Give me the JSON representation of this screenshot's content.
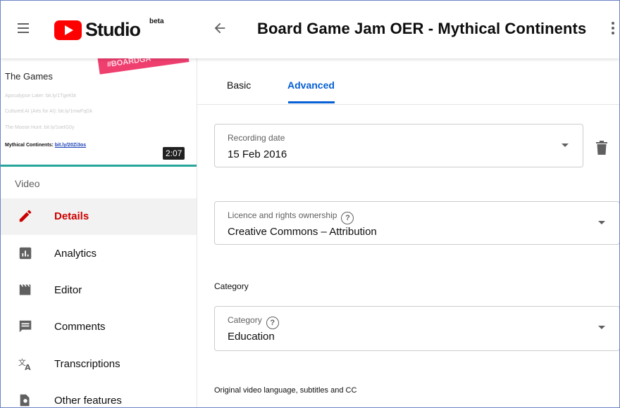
{
  "app": {
    "brand": "Studio",
    "beta": "beta",
    "brand_color": "#ff0000",
    "accent_color": "#065fd4"
  },
  "header": {
    "video_title": "Board Game Jam OER - Mythical Continents"
  },
  "thumbnail": {
    "tag_text": "#BOARDGA",
    "heading": "The Games",
    "lines": [
      "Apocalypse Later: bit.ly/1TgeKbt",
      "Cultured AI (Arts for AI): bit.ly/1mwFqGk",
      "The Moose Hunt: bit.ly/1oeIG0y"
    ],
    "highlight_prefix": "Mythical Continents: ",
    "highlight_link": "bit.ly/20Zi3os",
    "duration": "2:07"
  },
  "sidebar": {
    "section_label": "Video",
    "items": [
      {
        "label": "Details",
        "icon": "pencil-icon",
        "active": true
      },
      {
        "label": "Analytics",
        "icon": "analytics-icon"
      },
      {
        "label": "Editor",
        "icon": "clapper-icon"
      },
      {
        "label": "Comments",
        "icon": "comment-icon"
      },
      {
        "label": "Transcriptions",
        "icon": "translate-icon"
      },
      {
        "label": "Other features",
        "icon": "other-features-icon"
      }
    ]
  },
  "tabs": {
    "basic": "Basic",
    "advanced": "Advanced",
    "active": "Advanced"
  },
  "fields": {
    "recording_date": {
      "label": "Recording date",
      "value": "15 Feb 2016"
    },
    "licence": {
      "label": "Licence and rights ownership",
      "value": "Creative Commons – Attribution"
    },
    "category_heading": "Category",
    "category": {
      "label": "Category",
      "value": "Education"
    },
    "language_heading": "Original video language, subtitles and CC"
  }
}
